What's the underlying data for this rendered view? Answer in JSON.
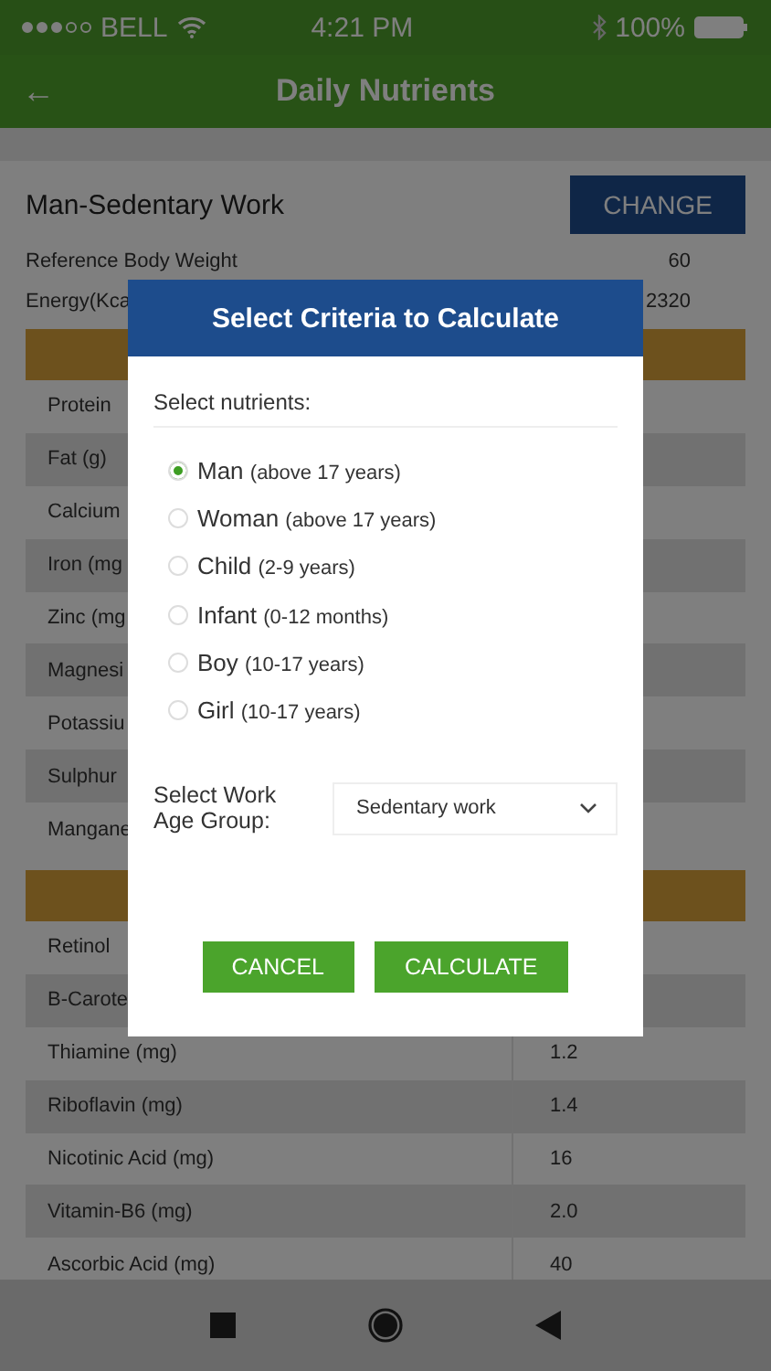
{
  "status_bar": {
    "carrier": "BELL",
    "time": "4:21 PM",
    "battery": "100%"
  },
  "header": {
    "back": "←",
    "title": "Daily Nutrients"
  },
  "profile": {
    "title": "Man-Sedentary Work",
    "button": "CHANGE"
  },
  "info": [
    {
      "label": "Reference Body Weight",
      "value": "60"
    },
    {
      "label": "Energy(Kca",
      "value": "2320"
    }
  ],
  "sections": [
    {
      "rows": [
        {
          "name": "Protein"
        },
        {
          "name": "Fat (g)"
        },
        {
          "name": "Calcium"
        },
        {
          "name": "Iron (mg"
        },
        {
          "name": "Zinc (mg"
        },
        {
          "name": "Magnesi"
        },
        {
          "name": "Potassiu"
        },
        {
          "name": "Sulphur"
        },
        {
          "name": "Mangane"
        }
      ]
    },
    {
      "rows": [
        {
          "name": "Retinol"
        },
        {
          "name": "B-Carote"
        },
        {
          "name": "Thiamine (mg)",
          "value": "1.2"
        },
        {
          "name": "Riboflavin (mg)",
          "value": "1.4"
        },
        {
          "name": "Nicotinic Acid (mg)",
          "value": "16"
        },
        {
          "name": "Vitamin-B6 (mg)",
          "value": "2.0"
        },
        {
          "name": "Ascorbic Acid (mg)",
          "value": "40"
        }
      ]
    }
  ],
  "dialog": {
    "title": "Select Criteria to Calculate",
    "prompt": "Select nutrients:",
    "options": [
      {
        "label": "Man",
        "note": "(above 17 years)",
        "selected": true
      },
      {
        "label": "Woman",
        "note": "(above 17 years)",
        "selected": false
      },
      {
        "label": "Child",
        "note": "(2-9 years)",
        "selected": false
      },
      {
        "label": "Infant",
        "note": "(0-12 months)",
        "selected": false
      },
      {
        "label": "Boy",
        "note": "(10-17 years)",
        "selected": false
      },
      {
        "label": "Girl",
        "note": "(10-17 years)",
        "selected": false
      }
    ],
    "work_label": "Select Work Age Group:",
    "work_value": "Sedentary work",
    "buttons": [
      {
        "label": "CANCEL"
      },
      {
        "label": "CALCULATE"
      }
    ]
  }
}
